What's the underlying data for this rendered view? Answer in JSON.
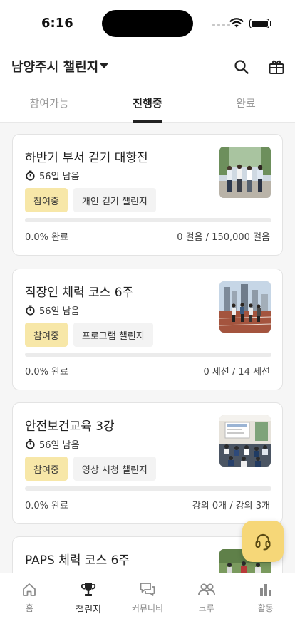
{
  "status_bar": {
    "time": "6:16"
  },
  "header": {
    "title": "남양주시 챌린지",
    "icons": {
      "search": "search-icon",
      "gift": "gift-icon",
      "caret": "caret-down-icon"
    }
  },
  "tabs": [
    {
      "label": "참여가능",
      "active": false
    },
    {
      "label": "진행중",
      "active": true
    },
    {
      "label": "완료",
      "active": false
    }
  ],
  "challenges": [
    {
      "title": "하반기 부서 걷기 대항전",
      "days_left": "56일 남음",
      "status_badge": "참여중",
      "type_badge": "개인 걷기 챌린지",
      "progress_percent": 0.0,
      "progress_label": "0.0% 완료",
      "progress_detail": "0 걸음 / 150,000 걸음",
      "thumbnail": "office-workers-walking-photo"
    },
    {
      "title": "직장인 체력 코스 6주",
      "days_left": "56일 남음",
      "status_badge": "참여중",
      "type_badge": "프로그램 챌린지",
      "progress_percent": 0.0,
      "progress_label": "0.0% 완료",
      "progress_detail": "0 세션 / 14 세션",
      "thumbnail": "running-track-photo"
    },
    {
      "title": "안전보건교육 3강",
      "days_left": "56일 남음",
      "status_badge": "참여중",
      "type_badge": "영상 시청 챌린지",
      "progress_percent": 0.0,
      "progress_label": "0.0% 완료",
      "progress_detail": "강의 0개 / 강의 3개",
      "thumbnail": "classroom-lecture-photo"
    },
    {
      "title": "PAPS 체력 코스 6주",
      "thumbnail": "outdoor-group-photo"
    }
  ],
  "fab": {
    "icon": "headset-icon"
  },
  "bottom_nav": [
    {
      "label": "홈",
      "icon": "home-icon",
      "active": false
    },
    {
      "label": "챌린지",
      "icon": "trophy-icon",
      "active": true
    },
    {
      "label": "커뮤니티",
      "icon": "chat-icon",
      "active": false
    },
    {
      "label": "크루",
      "icon": "people-icon",
      "active": false
    },
    {
      "label": "활동",
      "icon": "bar-chart-icon",
      "active": false
    }
  ],
  "colors": {
    "accent": "#f6d778",
    "status_badge_bg": "#f7e7a8",
    "progress_fill": "#d9b94a"
  }
}
